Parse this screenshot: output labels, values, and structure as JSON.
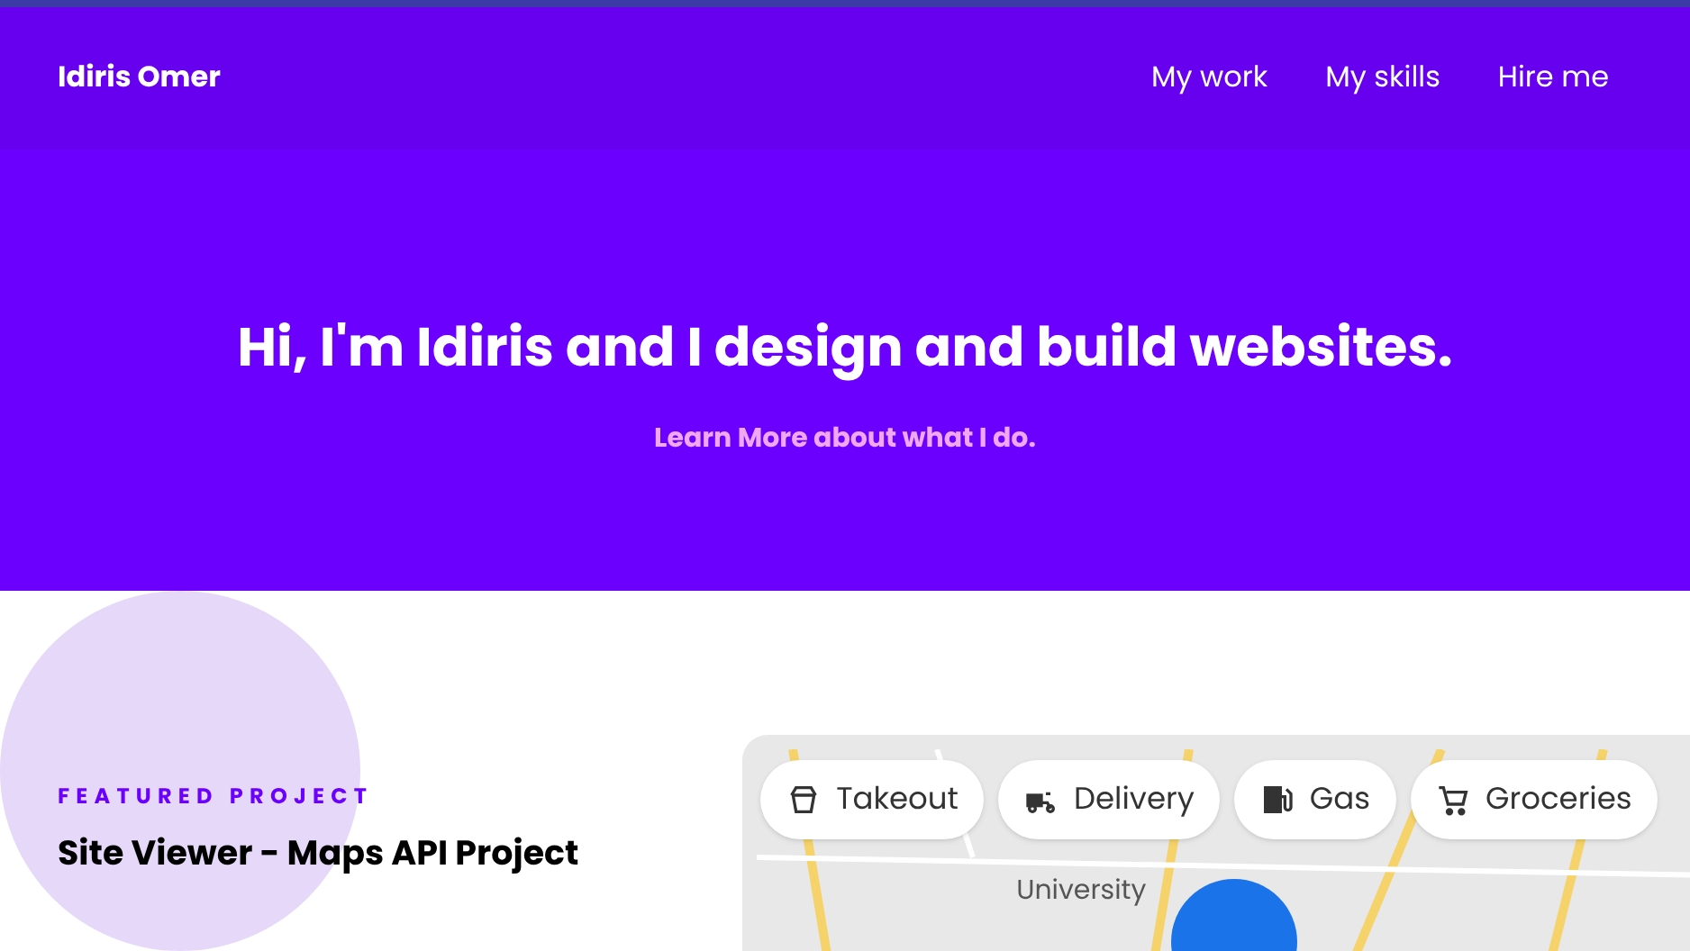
{
  "header": {
    "brand": "Idiris Omer",
    "nav": [
      {
        "label": "My work"
      },
      {
        "label": "My skills"
      },
      {
        "label": "Hire me"
      }
    ]
  },
  "hero": {
    "title": "Hi, I'm Idiris and I design and build websites.",
    "link": "Learn More about what I do."
  },
  "featured": {
    "eyebrow": "FEATURED PROJECT",
    "title": "Site Viewer - Maps API Project"
  },
  "map": {
    "chips": [
      {
        "kind": "takeout",
        "label": "Takeout"
      },
      {
        "kind": "delivery",
        "label": "Delivery"
      },
      {
        "kind": "gas",
        "label": "Gas"
      },
      {
        "kind": "groceries",
        "label": "Groceries"
      }
    ],
    "place_label": "University"
  }
}
